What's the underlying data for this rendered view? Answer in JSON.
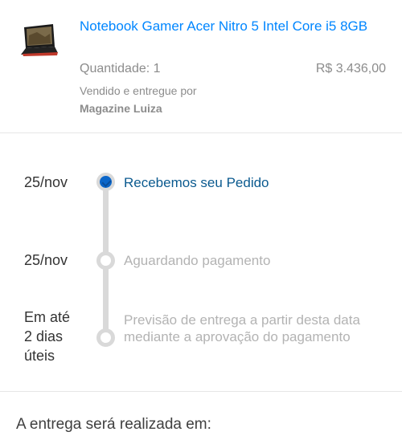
{
  "product": {
    "title": "Notebook Gamer Acer Nitro 5 Intel Core i5 8GB",
    "quantity": "Quantidade: 1",
    "price": "R$ 3.436,00",
    "sold_by_label": "Vendido e entregue por",
    "seller": "Magazine Luiza",
    "thumbnail_icon": "laptop-icon"
  },
  "timeline": {
    "steps": [
      {
        "date": "25/nov",
        "label": "Recebemos seu Pedido",
        "status": "done"
      },
      {
        "date": "25/nov",
        "label": "Aguardando pagamento",
        "status": "pending"
      },
      {
        "date_line1": "Em até",
        "date_line2": "2 dias",
        "date_line3": "úteis",
        "label": "Previsão de entrega a partir desta data mediante a aprovação do pagamento",
        "status": "pending"
      }
    ]
  },
  "delivery": {
    "heading": "A entrega será realizada em:"
  },
  "colors": {
    "accent": "#0086ff",
    "done": "#0b66c9",
    "muted": "#b3b3b3"
  }
}
